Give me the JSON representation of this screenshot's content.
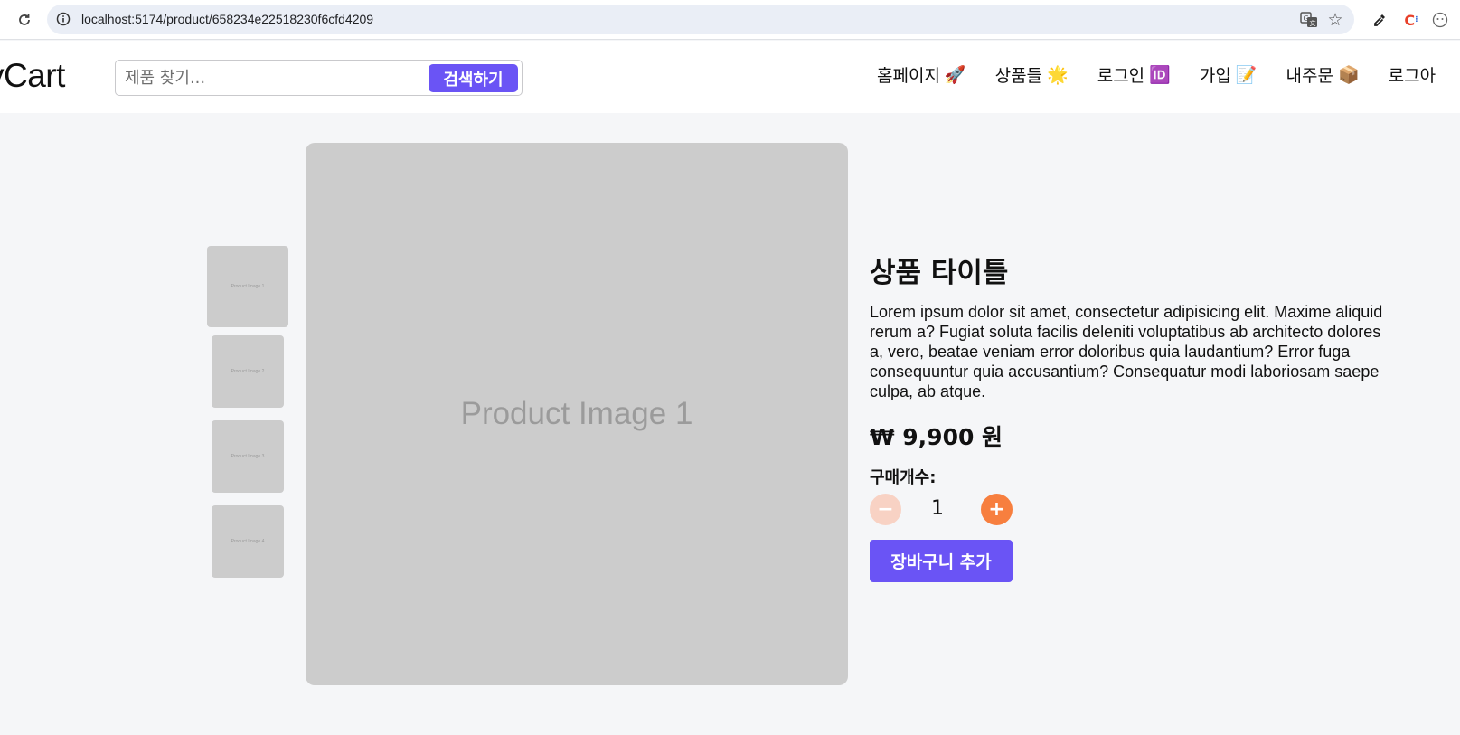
{
  "browser": {
    "url": "localhost:5174/product/658234e22518230f6cfd4209",
    "icons": [
      "reload-icon",
      "info-icon",
      "translate-icon",
      "star-icon",
      "eyedropper-icon",
      "extension-c-icon",
      "profile-icon"
    ]
  },
  "header": {
    "logo": "yCart",
    "search": {
      "placeholder": "제품 찾기...",
      "value": "",
      "button_label": "검색하기"
    },
    "nav": [
      {
        "label": "홈페이지",
        "emoji": "🚀"
      },
      {
        "label": "상품들",
        "emoji": "🌟"
      },
      {
        "label": "로그인",
        "emoji": "🆔"
      },
      {
        "label": "가입",
        "emoji": "📝"
      },
      {
        "label": "내주문",
        "emoji": "📦"
      },
      {
        "label": "로그아",
        "emoji": ""
      }
    ]
  },
  "gallery": {
    "thumbnails": [
      "Product Image 1",
      "Product Image 2",
      "Product Image 3",
      "Product Image 4"
    ],
    "main_label": "Product Image 1"
  },
  "product": {
    "title": "상품 타이틀",
    "description": "Lorem ipsum dolor sit amet, consectetur adipisicing elit. Maxime aliquid rerum a? Fugiat soluta facilis deleniti voluptatibus ab architecto dolores a, vero, beatae veniam error doloribus quia laudantium? Error fuga consequuntur quia accusantium? Consequatur modi laboriosam saepe culpa, ab atque.",
    "price": "₩ 9,900 원",
    "quantity_label": "구매개수:",
    "quantity": "1",
    "minus_label": "−",
    "plus_label": "+",
    "add_to_cart_label": "장바구니 추가"
  },
  "colors": {
    "accent": "#6a54f5",
    "plus_button": "#f77f3f",
    "minus_button": "#f8d2c4",
    "placeholder_gray": "#cccccc",
    "page_background": "#f5f6f8"
  }
}
